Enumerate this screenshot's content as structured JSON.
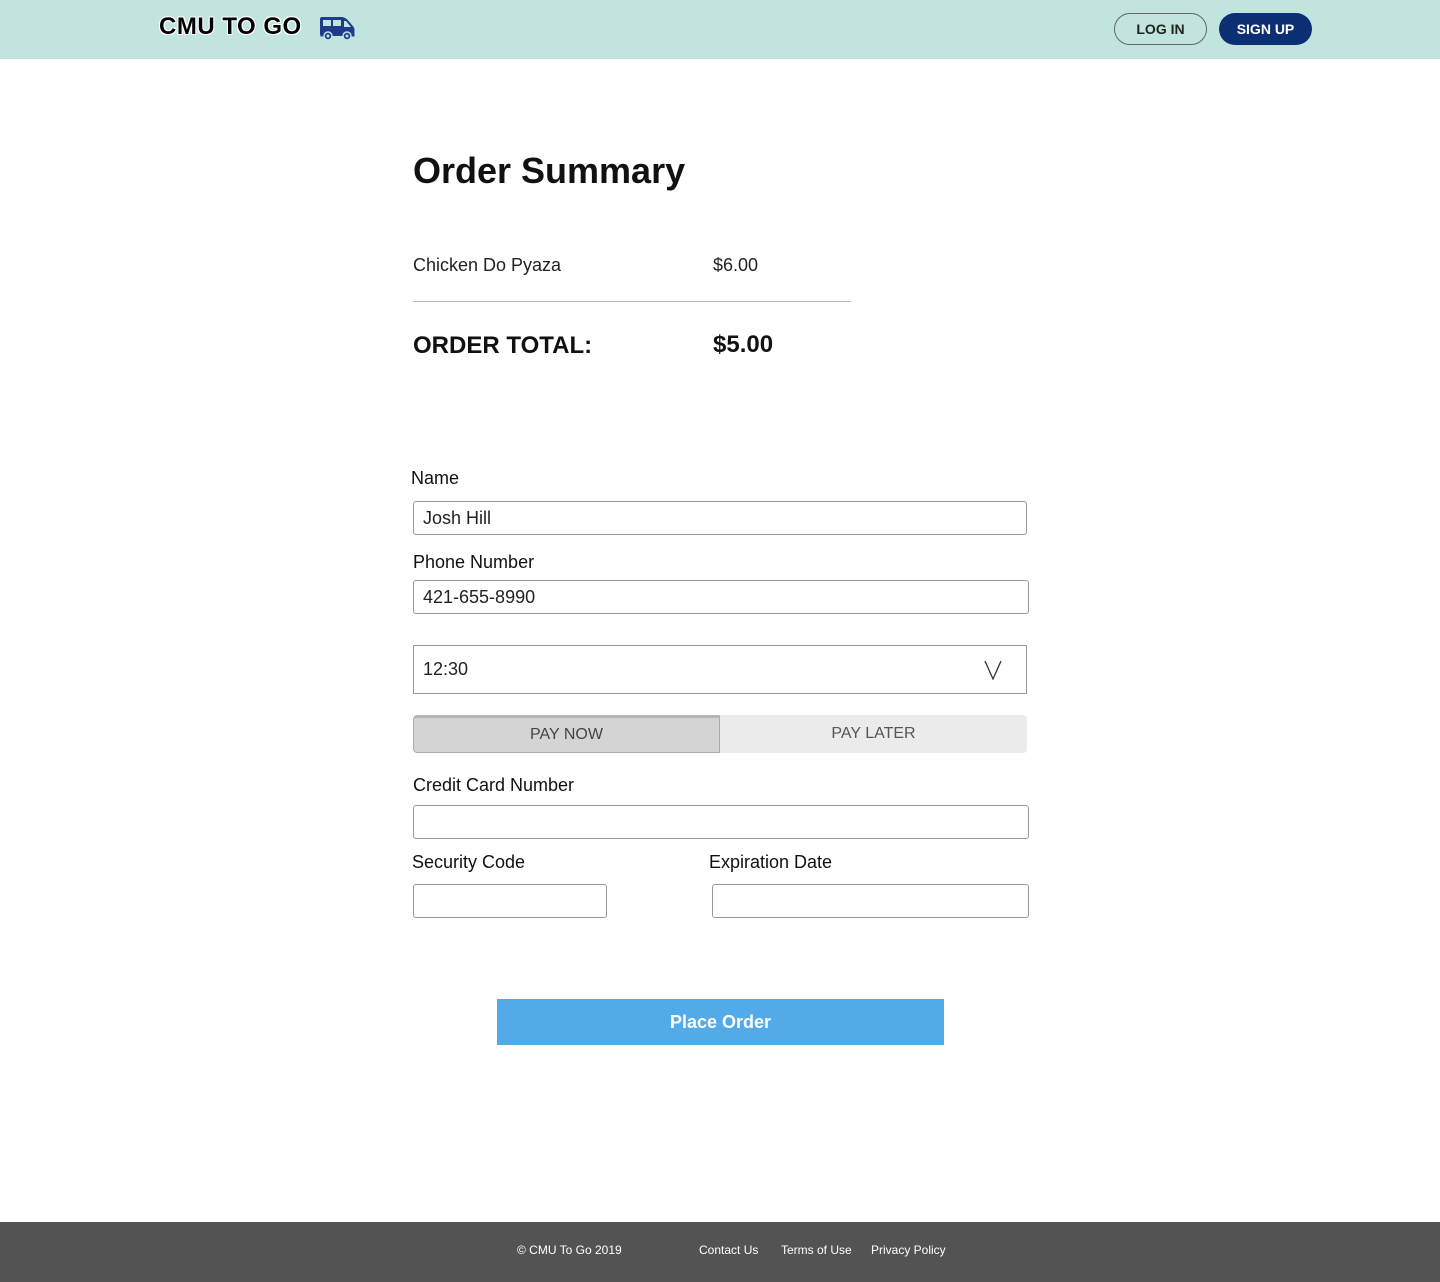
{
  "header": {
    "logo_text": "CMU TO GO",
    "logo_icon": "van-icon",
    "login_label": "LOG IN",
    "signup_label": "SIGN UP",
    "colors": {
      "header_bg": "#c1e4de",
      "signup_bg": "#0c2f73"
    }
  },
  "summary": {
    "title": "Order Summary",
    "items": [
      {
        "name": "Chicken Do Pyaza",
        "price": "$6.00"
      }
    ],
    "total_label": "ORDER TOTAL:",
    "total_value": "$5.00"
  },
  "form": {
    "name_label": "Name",
    "name_value": "Josh Hill",
    "phone_label": "Phone Number",
    "phone_value": "421-655-8990",
    "time_value": "12:30",
    "pay_now_label": "PAY NOW",
    "pay_later_label": "PAY LATER",
    "card_label": "Credit Card Number",
    "card_value": "",
    "security_label": "Security Code",
    "security_value": "",
    "expiration_label": "Expiration Date",
    "expiration_value": ""
  },
  "place_order_label": "Place Order",
  "footer": {
    "copyright": "© CMU To Go 2019",
    "links": [
      "Contact Us",
      "Terms of Use",
      "Privacy Policy"
    ]
  }
}
